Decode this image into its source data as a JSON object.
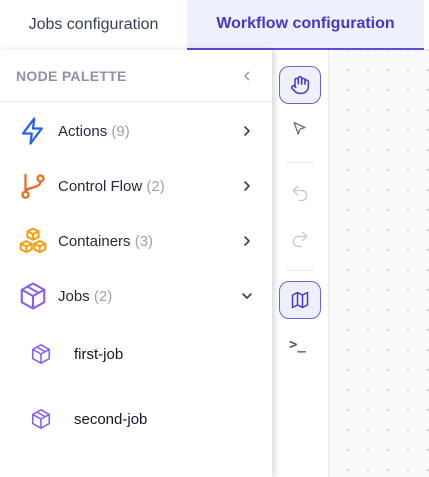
{
  "tabs": [
    {
      "label": "Jobs configuration",
      "active": false
    },
    {
      "label": "Workflow configuration",
      "active": true
    }
  ],
  "palette": {
    "title": "NODE PALETTE",
    "categories": [
      {
        "label": "Actions",
        "count": "(9)",
        "icon": "lightning-icon",
        "color": "#2563eb",
        "expanded": false
      },
      {
        "label": "Control Flow",
        "count": "(2)",
        "icon": "branch-icon",
        "color": "#ea6a1f",
        "expanded": false
      },
      {
        "label": "Containers",
        "count": "(3)",
        "icon": "boxes-icon",
        "color": "#f59e0b",
        "expanded": false
      },
      {
        "label": "Jobs",
        "count": "(2)",
        "icon": "cube-icon",
        "color": "#8b5cf6",
        "expanded": true
      }
    ],
    "jobs": [
      {
        "label": "first-job",
        "icon": "cube-icon"
      },
      {
        "label": "second-job",
        "icon": "cube-icon"
      }
    ]
  },
  "toolbar": {
    "terminal_label": ">_",
    "tools": [
      "hand-icon",
      "pointer-icon",
      "undo-icon",
      "redo-icon",
      "map-icon",
      "terminal-icon"
    ]
  },
  "colors": {
    "accent": "#5b4fd6",
    "active_tab_bg": "#eef0fb"
  }
}
